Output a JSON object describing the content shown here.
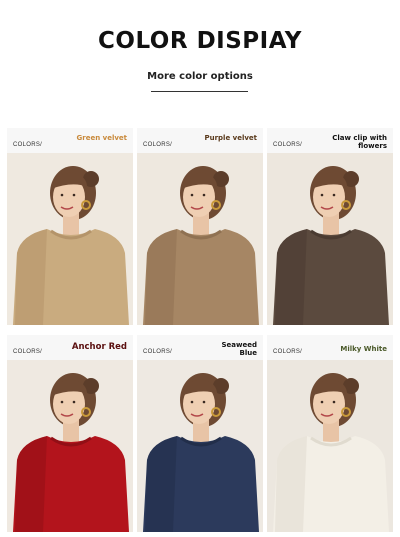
{
  "header": {
    "title": "COLOR DISPIAY",
    "subtitle": "More color options"
  },
  "cards": [
    {
      "label": "COLORS/",
      "name": "Green velvet",
      "name_color": "#c98a3c",
      "sweater_color": "#c9ab7f",
      "sweater_shade": "#b4946a",
      "bg_color": "#efe9e0"
    },
    {
      "label": "COLORS/",
      "name": "Purple velvet",
      "name_color": "#5a3a1c",
      "sweater_color": "#a68664",
      "sweater_shade": "#8f7152",
      "bg_color": "#eee8df"
    },
    {
      "label": "COLORS/",
      "name": "Claw clip with flowers",
      "name_color": "#111111",
      "sweater_color": "#5b4a3e",
      "sweater_shade": "#4a3b31",
      "bg_color": "#ede7de"
    },
    {
      "label": "COLORS/",
      "name": "Anchor Red",
      "name_color": "#5a0f0f",
      "sweater_color": "#b3141c",
      "sweater_shade": "#920f16",
      "bg_color": "#efe9e1"
    },
    {
      "label": "COLORS/",
      "name": "Seaweed Blue",
      "name_color": "#111111",
      "sweater_color": "#2c3a5c",
      "sweater_shade": "#222e4a",
      "bg_color": "#eee9e2"
    },
    {
      "label": "COLORS/",
      "name": "Milky White",
      "name_color": "#4b5a2a",
      "sweater_color": "#f3efe6",
      "sweater_shade": "#e0dbcf",
      "bg_color": "#ece7df"
    }
  ]
}
